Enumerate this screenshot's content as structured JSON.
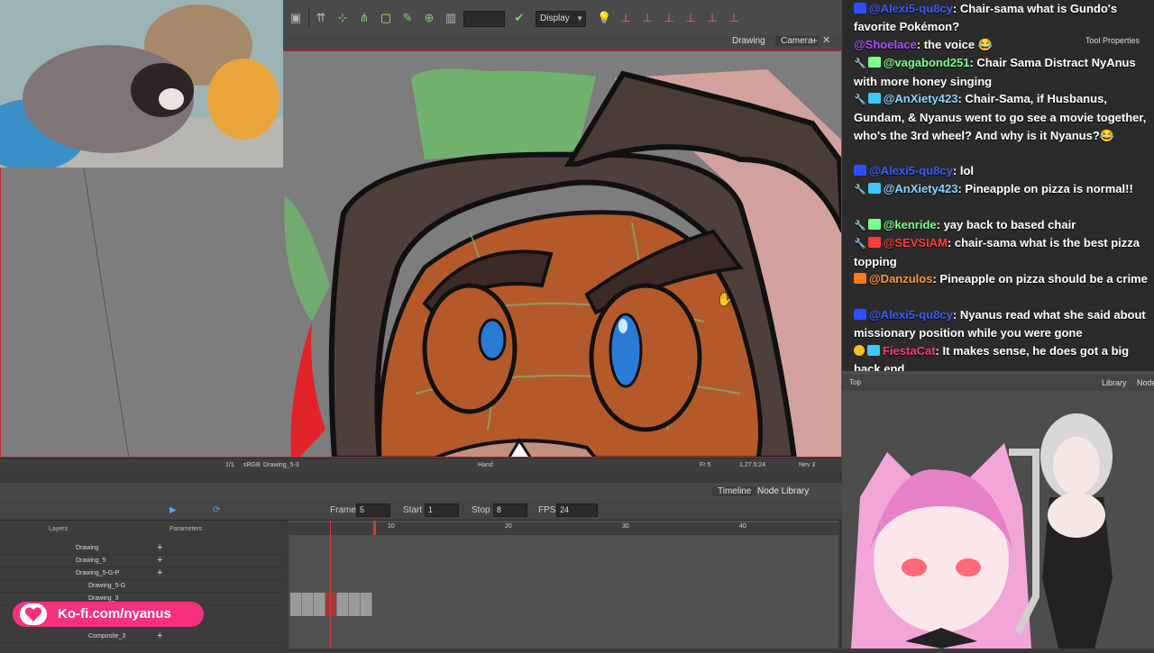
{
  "toolbar": {
    "display_select": "Display",
    "icons": [
      "layout-icon",
      "select-tool-icon",
      "transform-tool-icon",
      "rig-tool-icon",
      "frame-icon",
      "pencil-icon",
      "camera-icon",
      "blank-icon",
      "check-icon",
      "light-icon",
      "onion-skin-icons"
    ]
  },
  "view_tabs": {
    "drawing": "Drawing",
    "camera": "Camera",
    "add": "+",
    "close": "✕"
  },
  "statusbar": {
    "colorspace": "sRGB",
    "drawing": "Drawing_5-3",
    "tool": "Hand",
    "frame": "Fr 5",
    "zoom": "1.27.5:24",
    "layer": "Nev 3",
    "scale": "1/1"
  },
  "timeline": {
    "tabs": [
      "Timeline",
      "Node Library"
    ],
    "frame_label": "Frame",
    "frame_value": "5",
    "start_label": "Start",
    "start_value": "1",
    "stop_label": "Stop",
    "stop_value": "8",
    "fps_label": "FPS",
    "fps_value": "24",
    "layers_header": "Layers",
    "params_header": "Parameters",
    "layers": [
      "Drawing",
      "Drawing_5",
      "Drawing_5-G-P",
      "Drawing_5-G",
      "Drawing_3",
      "Composite_3"
    ],
    "frame_numbers": [
      "10",
      "20",
      "30",
      "40"
    ]
  },
  "chat": {
    "messages": [
      {
        "user": "@Alexi5-qu8cy",
        "text": ": Chair-sama what is Gundo's favorite Pokémon?",
        "user_color": "#3b5bff"
      },
      {
        "user": "@Shoelace",
        "text": ": the voice 😂",
        "user_color": "#b04cff"
      },
      {
        "user": "@vagabond251",
        "text": ": Chair Sama Distract NyAnus with more honey singing",
        "user_color": "#7cff8a"
      },
      {
        "user": "@AnXiety423",
        "text": ": Chair-Sama, if Husbanus, Gundam, & Nyanus went to go see a movie together, who's the 3rd wheel? And why is it Nyanus?😂",
        "user_color": "#8fd3ff"
      },
      {
        "user": "@Alexi5-qu8cy",
        "text": ": lol",
        "user_color": "#3b5bff"
      },
      {
        "user": "@AnXiety423",
        "text": ": Pineapple on pizza is normal!!",
        "user_color": "#8fd3ff"
      },
      {
        "user": "@kenride",
        "text": ": yay back to based chair",
        "user_color": "#7cff8a"
      },
      {
        "user": "@SEVSIAM",
        "text": ": chair-sama what is the best pizza topping",
        "user_color": "#ff3b3b"
      },
      {
        "user": "@Danzulos",
        "text": ": Pineapple on pizza should be a crime",
        "user_color": "#ff9a3b"
      },
      {
        "user": "@Alexi5-qu8cy",
        "text": ": Nyanus read what she said about missionary position while you were gone",
        "user_color": "#3b5bff"
      },
      {
        "user": "FiestaCat",
        "text": ": It makes sense, he does got a big back end",
        "user_color": "#ff3b6e"
      }
    ]
  },
  "right_panel": {
    "tool_properties": "Tool Properties",
    "library_tab": "Library",
    "node_tab": "Node",
    "top_label": "Top"
  },
  "kofi": {
    "text": "Ko-fi.com/nyanus"
  },
  "colors": {
    "accent_red": "#c0262e",
    "kofi_pink": "#f5317f",
    "panel_dark": "#3a3a3a"
  }
}
